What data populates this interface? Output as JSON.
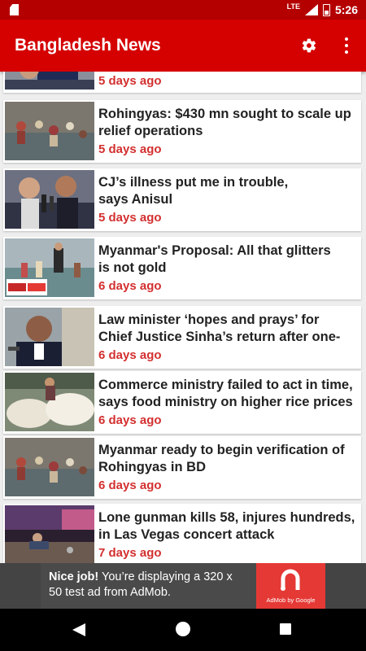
{
  "status_bar": {
    "network": "LTE",
    "time": "5:26",
    "icons": [
      "sd-card-icon",
      "lte-signal-icon",
      "battery-charging-icon"
    ]
  },
  "app_bar": {
    "title": "Bangladesh News",
    "actions": [
      "settings-gear-icon",
      "more-vert-icon"
    ]
  },
  "articles": [
    {
      "headline_lines": [
        "",
        ""
      ],
      "time": "5 days ago",
      "thumbnail": "news-photo-officials"
    },
    {
      "headline_lines": [
        "Rohingyas: $430 mn sought to scale up",
        "relief operations"
      ],
      "time": "5 days ago",
      "thumbnail": "news-photo-refugees-in-water"
    },
    {
      "headline_lines": [
        "CJ’s illness put me in trouble,",
        "says Anisul"
      ],
      "time": "5 days ago",
      "thumbnail": "news-photo-press-conference"
    },
    {
      "headline_lines": [
        "Myanmar's Proposal: All that glitters",
        "is not gold"
      ],
      "time": "6 days ago",
      "thumbnail": "news-photo-river-refugees"
    },
    {
      "headline_lines": [
        "Law minister ‘hopes and prays’ for",
        "Chief Justice Sinha’s return after one-"
      ],
      "time": "6 days ago",
      "thumbnail": "news-photo-minister-speaking"
    },
    {
      "headline_lines": [
        "Commerce ministry failed to act in time,",
        "says food ministry on higher rice prices"
      ],
      "time": "6 days ago",
      "thumbnail": "news-photo-rice-sacks"
    },
    {
      "headline_lines": [
        "Myanmar ready to begin verification of",
        "Rohingyas in BD"
      ],
      "time": "6 days ago",
      "thumbnail": "news-photo-refugees-in-water"
    },
    {
      "headline_lines": [
        "Lone gunman kills 58, injures hundreds,",
        "in Las Vegas concert attack"
      ],
      "time": "7 days ago",
      "thumbnail": "news-photo-concert-scene"
    }
  ],
  "ad": {
    "bold": "Nice job!",
    "text": " You’re displaying a 320 x 50 test ad from AdMob.",
    "brand": "AdMob by Google",
    "logo": "admob-logo-icon"
  },
  "nav_bar": [
    "back-icon",
    "home-icon",
    "recents-icon"
  ],
  "colors": {
    "status_bar": "#b50000",
    "app_bar": "#d50000",
    "time_text": "#d32f2f",
    "headline_text": "#222222",
    "ad_logo": "#e53935"
  }
}
